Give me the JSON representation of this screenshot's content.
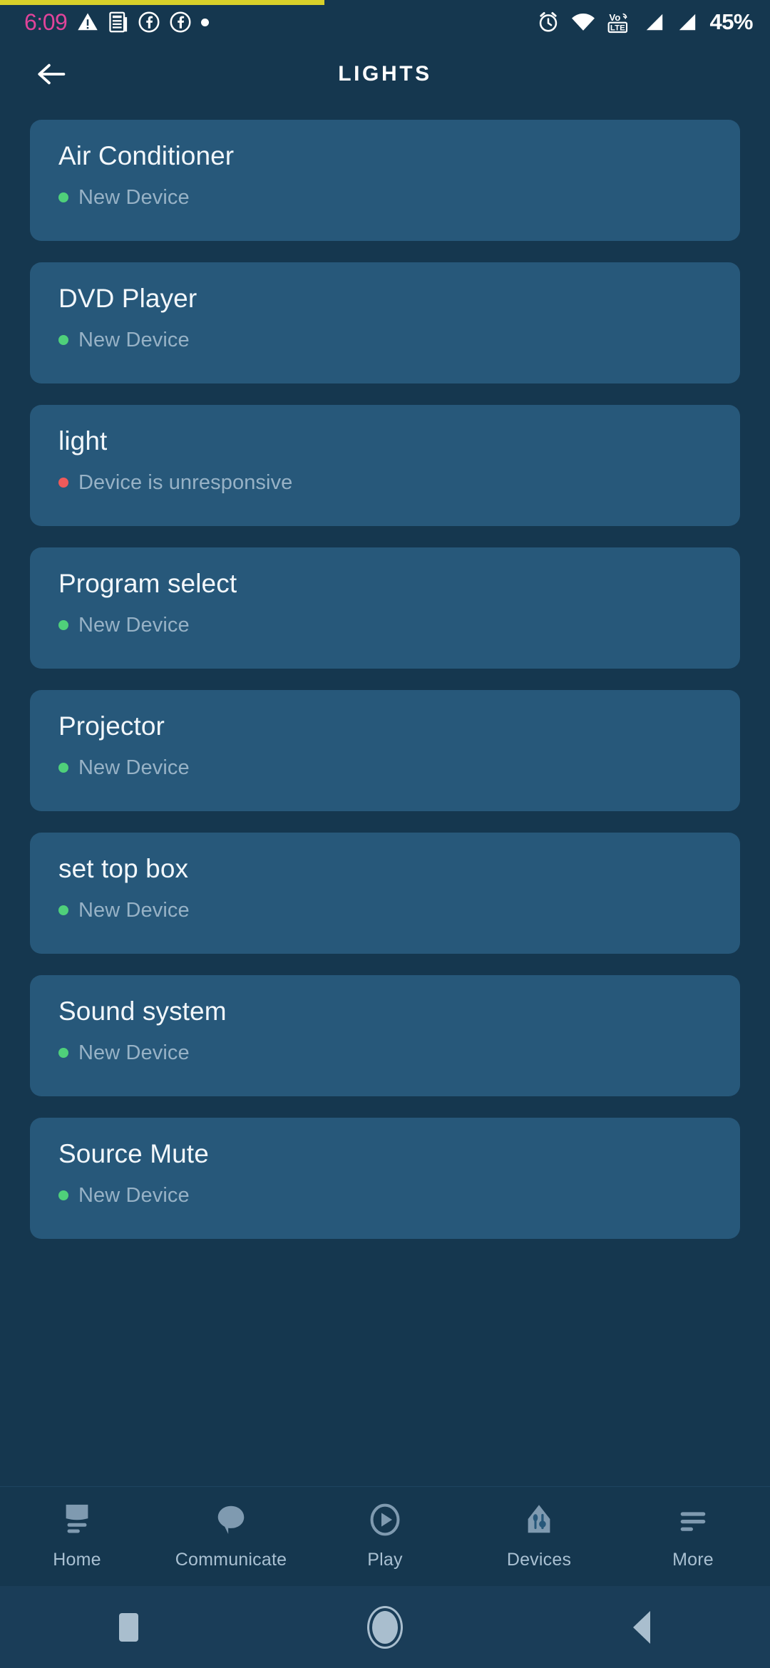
{
  "status_bar": {
    "time": "6:09",
    "battery": "45%",
    "left_icons": [
      "warning-triangle-icon",
      "news-document-icon",
      "facebook-icon",
      "facebook-icon",
      "dot-icon"
    ],
    "right_icons": [
      "alarm-clock-icon",
      "wifi-icon",
      "volte-icon",
      "signal-bar-icon",
      "signal-bar-icon"
    ],
    "network_label": "VoLTE",
    "time_color": "#e0449a"
  },
  "app_bar": {
    "title": "LIGHTS",
    "back_icon": "arrow-left-icon"
  },
  "theme": {
    "background": "#15374f",
    "card": "#27587a",
    "title_text": "#f2f7fb",
    "status_text": "#97b2c6",
    "online_dot": "#4fd07a",
    "offline_dot": "#ef5a5a",
    "accent_progress": "#d8d02a",
    "tab_icon": "#7f9ab0",
    "tab_label": "#a9c0d2"
  },
  "devices": [
    {
      "name": "Air Conditioner",
      "status": "New Device",
      "state": "online"
    },
    {
      "name": "DVD Player",
      "status": "New Device",
      "state": "online"
    },
    {
      "name": "light",
      "status": "Device is unresponsive",
      "state": "offline"
    },
    {
      "name": "Program select",
      "status": "New Device",
      "state": "online"
    },
    {
      "name": "Projector",
      "status": "New Device",
      "state": "online"
    },
    {
      "name": "set top box",
      "status": "New Device",
      "state": "online"
    },
    {
      "name": "Sound system",
      "status": "New Device",
      "state": "online"
    },
    {
      "name": "Source Mute",
      "status": "New Device",
      "state": "online"
    }
  ],
  "tab_bar": {
    "items": [
      {
        "label": "Home",
        "icon": "monitor-icon"
      },
      {
        "label": "Communicate",
        "icon": "speech-bubble-icon"
      },
      {
        "label": "Play",
        "icon": "play-circle-icon"
      },
      {
        "label": "Devices",
        "icon": "home-devices-icon"
      },
      {
        "label": "More",
        "icon": "hamburger-menu-icon"
      }
    ]
  },
  "android_nav": {
    "recents": "recents-square-icon",
    "home": "home-circle-icon",
    "back": "back-triangle-icon"
  }
}
